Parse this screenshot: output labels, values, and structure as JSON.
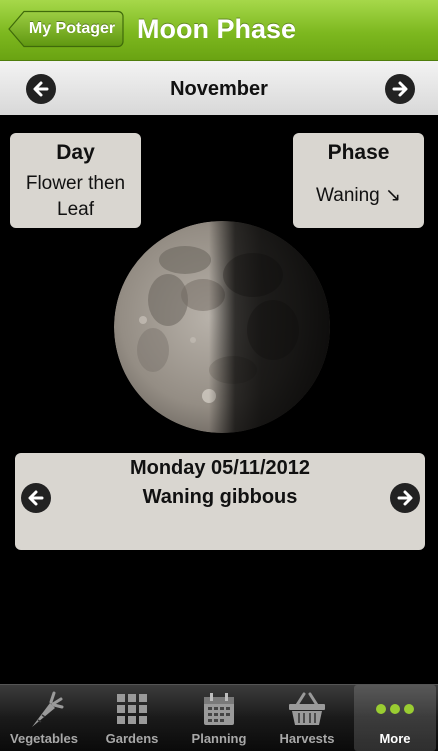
{
  "navbar": {
    "back_label": "My Potager",
    "title": "Moon Phase"
  },
  "month_bar": {
    "month": "November"
  },
  "day_card": {
    "title": "Day",
    "line1": "Flower then",
    "line2": "Leaf"
  },
  "phase_card": {
    "title": "Phase",
    "value": "Waning ↘"
  },
  "date_card": {
    "date": "Monday 05/11/2012",
    "phase_name": "Waning gibbous"
  },
  "tabs": [
    {
      "label": "Vegetables",
      "icon": "carrot-icon"
    },
    {
      "label": "Gardens",
      "icon": "grid-icon"
    },
    {
      "label": "Planning",
      "icon": "calendar-icon"
    },
    {
      "label": "Harvests",
      "icon": "basket-icon"
    },
    {
      "label": "More",
      "icon": "more-dots-icon",
      "active": true
    }
  ],
  "colors": {
    "accent": "#7db81f",
    "card": "#d9d6d0",
    "active_dots": "#9acd32"
  }
}
